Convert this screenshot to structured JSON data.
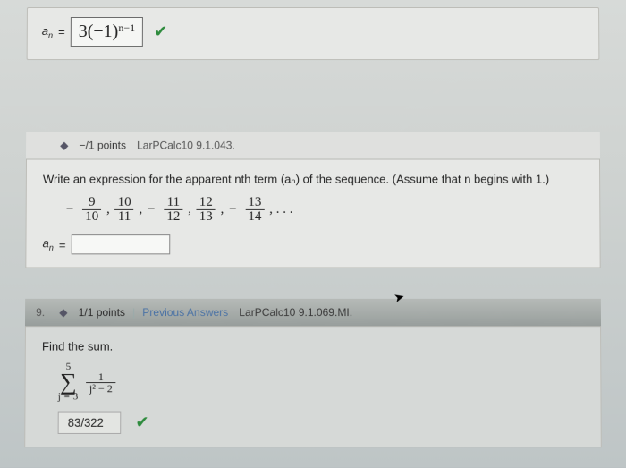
{
  "q7": {
    "an_label_base": "a",
    "an_label_sub": "n",
    "equals": " = ",
    "answer_display": "3(−1)",
    "answer_exp": "n−1"
  },
  "q8": {
    "points_text": "−/1 points",
    "source": "LarPCalc10 9.1.043.",
    "prompt": "Write an expression for the apparent nth term (aₙ) of the sequence. (Assume that n begins with 1.)",
    "seq": {
      "t1": {
        "neg": "−",
        "top": "9",
        "bot": "10"
      },
      "t2": {
        "top": "10",
        "bot": "11"
      },
      "t3": {
        "neg": "−",
        "top": "11",
        "bot": "12"
      },
      "t4": {
        "top": "12",
        "bot": "13"
      },
      "t5": {
        "neg": "−",
        "top": "13",
        "bot": "14"
      },
      "ell": ", . . ."
    },
    "an_label_base": "a",
    "an_label_sub": "n",
    "equals": " = "
  },
  "q9": {
    "number": "9.",
    "points_text": "1/1 points",
    "prev_link": "Previous Answers",
    "source": "LarPCalc10 9.1.069.MI.",
    "prompt": "Find the sum.",
    "sum": {
      "upper": "5",
      "lower": "j = 3",
      "expr_top": "1",
      "expr_bot": "j² − 2"
    },
    "result": "83/322"
  }
}
